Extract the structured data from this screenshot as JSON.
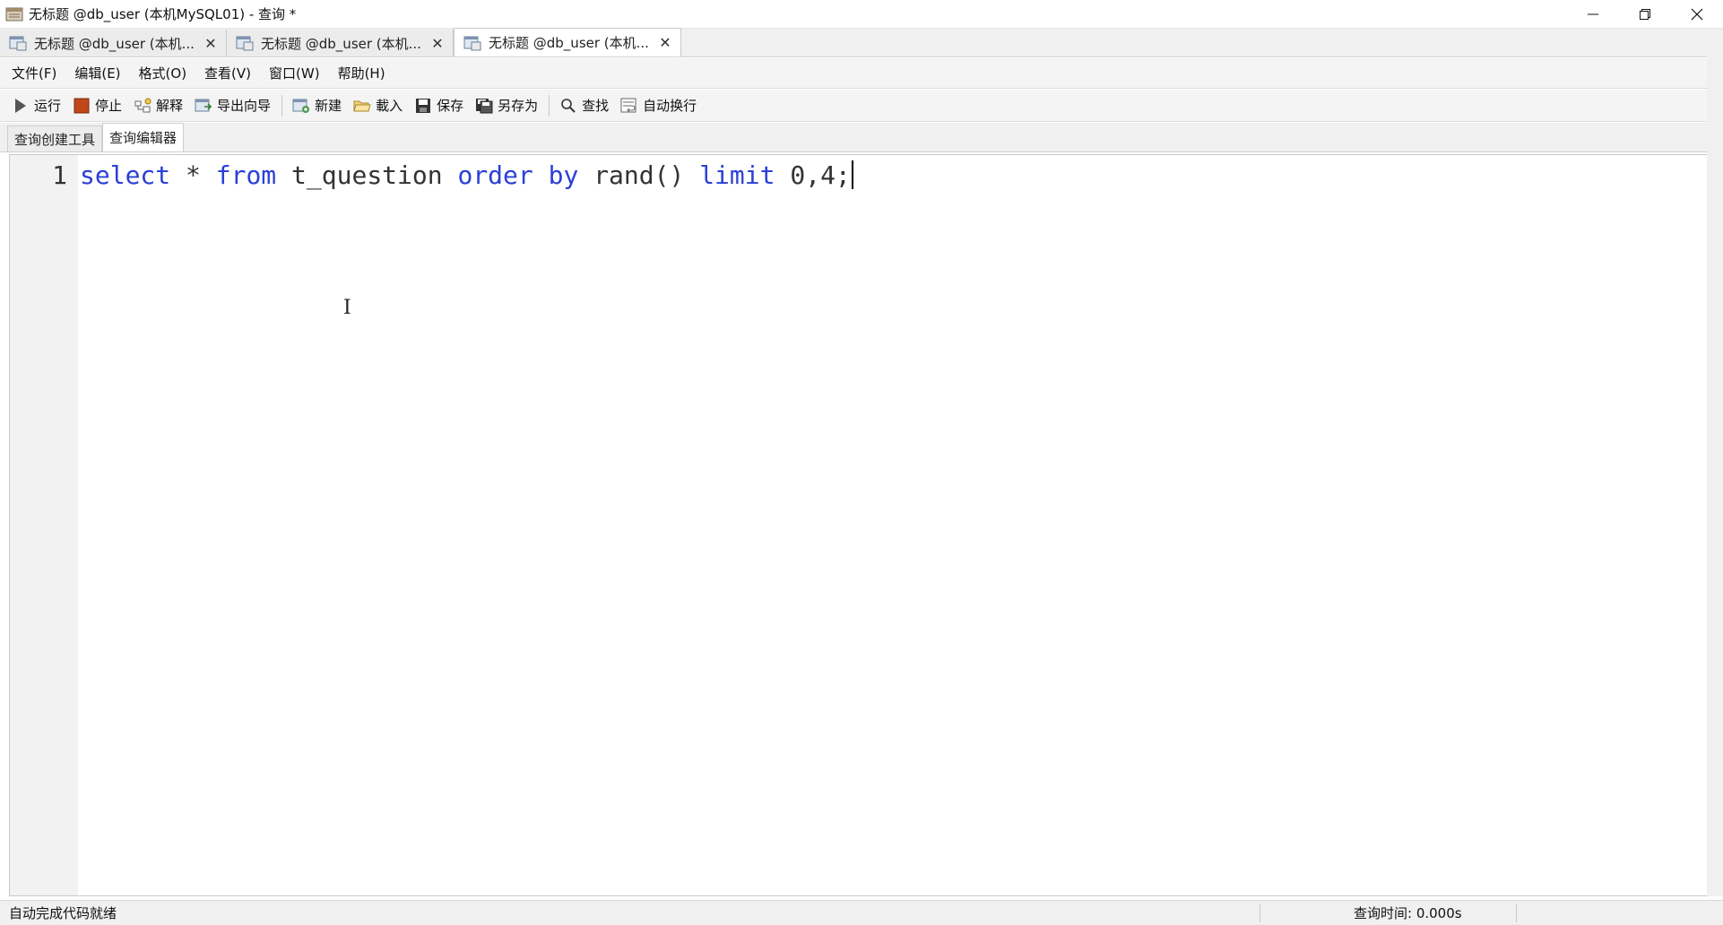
{
  "window": {
    "title": "无标题 @db_user (本机MySQL01) - 查询 *"
  },
  "doc_tabs": [
    {
      "label": "无标题 @db_user (本机...",
      "active": false
    },
    {
      "label": "无标题 @db_user (本机...",
      "active": false
    },
    {
      "label": "无标题 @db_user (本机...",
      "active": true
    }
  ],
  "menu": [
    "文件(F)",
    "编辑(E)",
    "格式(O)",
    "查看(V)",
    "窗口(W)",
    "帮助(H)"
  ],
  "toolbar": {
    "run": "运行",
    "stop": "停止",
    "explain": "解释",
    "export": "导出向导",
    "new": "新建",
    "load": "載入",
    "save": "保存",
    "save_as": "另存为",
    "find": "查找",
    "word_wrap": "自动换行"
  },
  "sub_tabs": [
    "查询创建工具",
    "查询编辑器"
  ],
  "editor": {
    "line_number": "1",
    "tokens": {
      "t1": "select",
      "t2": " * ",
      "t3": "from",
      "t4": " t_question ",
      "t5": "order",
      "t6": " ",
      "t7": "by",
      "t8": " rand() ",
      "t9": "limit",
      "t10": " 0,4;"
    }
  },
  "status": {
    "left": "自动完成代码就绪",
    "query_time": "查询时间: 0.000s"
  },
  "colors": {
    "keyword": "#2a3fd6",
    "stop_icon": "#c0471a"
  }
}
